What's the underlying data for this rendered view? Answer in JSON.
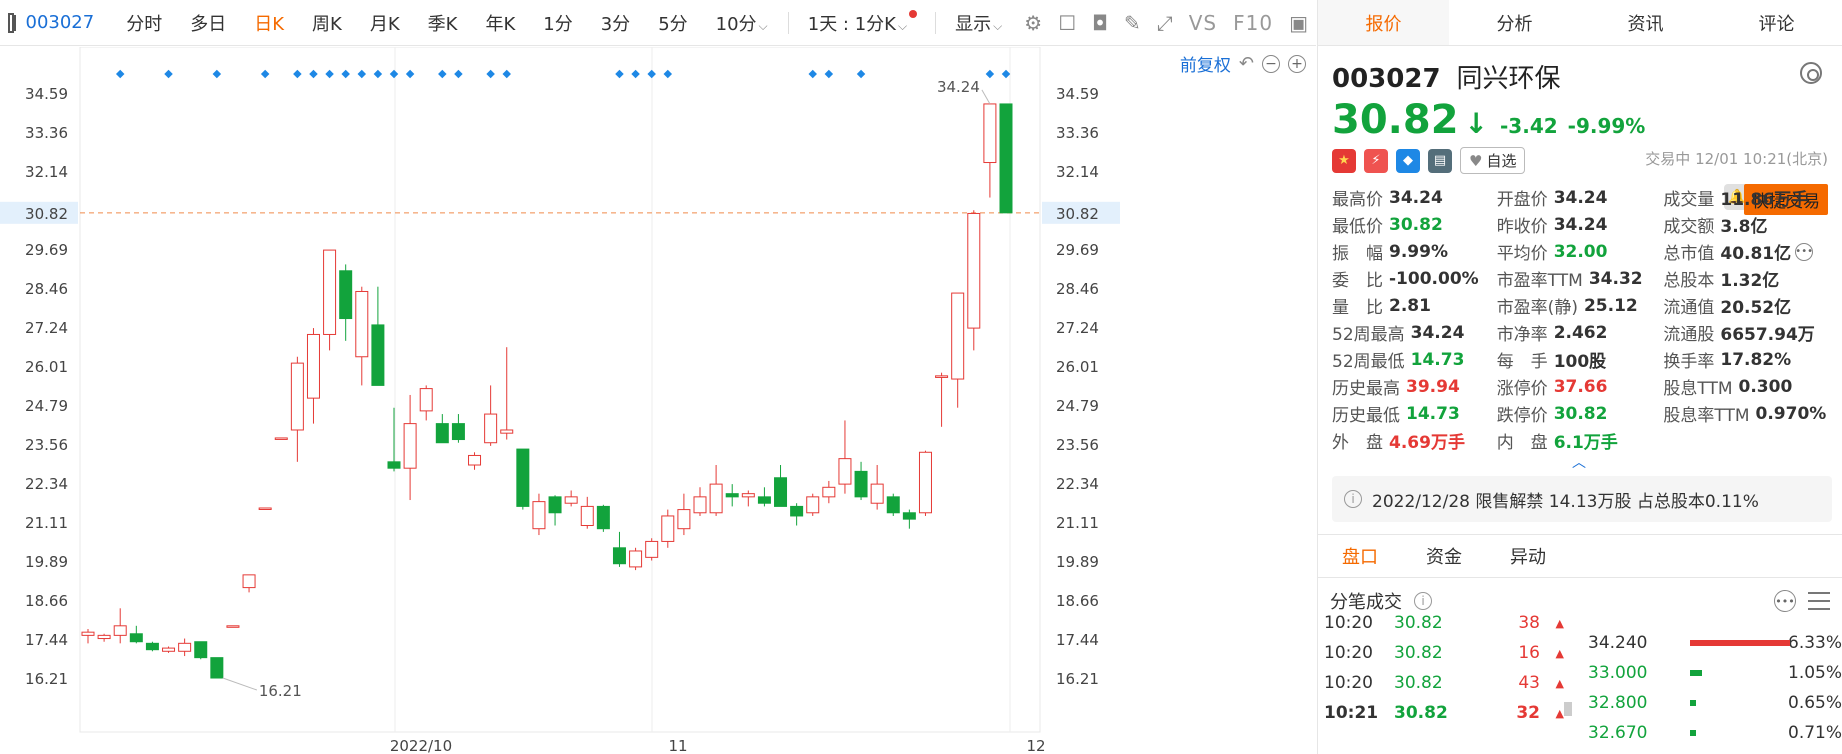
{
  "toolbar": {
    "code": "003027",
    "items": [
      "分时",
      "多日",
      "日K",
      "周K",
      "月K",
      "季K",
      "年K",
      "1分",
      "3分",
      "5分"
    ],
    "active": "日K",
    "period_select": "10分",
    "range_select": "1天 : 1分K",
    "display_label": "显示",
    "vs_label": "VS",
    "f10_label": "F10"
  },
  "chart": {
    "fq_label": "前复权",
    "last_price": "30.82",
    "high_label": "34.24",
    "low_label": "16.21",
    "x_labels": [
      "2022/10",
      "11",
      "12"
    ]
  },
  "chart_data": {
    "type": "candlestick",
    "y_ticks": [
      34.59,
      33.36,
      32.14,
      30.82,
      29.69,
      28.46,
      27.24,
      26.01,
      24.79,
      23.56,
      22.34,
      21.11,
      19.89,
      18.66,
      17.44,
      16.21
    ],
    "ylim": [
      15.3,
      35.4
    ],
    "x_labels": [
      "2022/10",
      "11",
      "12"
    ],
    "candles": [
      {
        "o": 17.55,
        "c": 17.65,
        "h": 17.75,
        "l": 17.3
      },
      {
        "o": 17.45,
        "c": 17.55,
        "h": 17.6,
        "l": 17.35
      },
      {
        "o": 17.55,
        "c": 17.85,
        "h": 18.4,
        "l": 17.3
      },
      {
        "o": 17.6,
        "c": 17.35,
        "h": 17.85,
        "l": 17.3
      },
      {
        "o": 17.3,
        "c": 17.1,
        "h": 17.35,
        "l": 17.05
      },
      {
        "o": 17.05,
        "c": 17.15,
        "h": 17.2,
        "l": 17.0
      },
      {
        "o": 17.05,
        "c": 17.3,
        "h": 17.45,
        "l": 16.9
      },
      {
        "o": 17.35,
        "c": 16.85,
        "h": 17.35,
        "l": 16.8
      },
      {
        "o": 16.85,
        "c": 16.21,
        "h": 16.85,
        "l": 16.21
      },
      {
        "o": 17.85,
        "c": 17.85,
        "h": 17.85,
        "l": 17.85
      },
      {
        "o": 19.05,
        "c": 19.45,
        "h": 19.45,
        "l": 18.9
      },
      {
        "o": 21.55,
        "c": 21.55,
        "h": 21.55,
        "l": 21.55
      },
      {
        "o": 23.75,
        "c": 23.75,
        "h": 23.75,
        "l": 23.75
      },
      {
        "o": 24.0,
        "c": 26.1,
        "h": 26.3,
        "l": 23.0
      },
      {
        "o": 25.0,
        "c": 27.0,
        "h": 27.2,
        "l": 24.2
      },
      {
        "o": 27.0,
        "c": 29.65,
        "h": 29.65,
        "l": 26.5
      },
      {
        "o": 29.0,
        "c": 27.5,
        "h": 29.2,
        "l": 26.8
      },
      {
        "o": 26.3,
        "c": 28.35,
        "h": 28.5,
        "l": 25.4
      },
      {
        "o": 27.3,
        "c": 25.4,
        "h": 28.5,
        "l": 25.4
      },
      {
        "o": 23.0,
        "c": 22.8,
        "h": 24.7,
        "l": 22.7
      },
      {
        "o": 22.8,
        "c": 24.2,
        "h": 25.1,
        "l": 21.8
      },
      {
        "o": 24.6,
        "c": 25.3,
        "h": 25.4,
        "l": 24.3
      },
      {
        "o": 24.2,
        "c": 23.6,
        "h": 24.5,
        "l": 23.6
      },
      {
        "o": 24.2,
        "c": 23.7,
        "h": 24.5,
        "l": 23.6
      },
      {
        "o": 22.9,
        "c": 23.2,
        "h": 23.3,
        "l": 22.75
      },
      {
        "o": 23.6,
        "c": 24.5,
        "h": 25.4,
        "l": 23.5
      },
      {
        "o": 23.9,
        "c": 24.0,
        "h": 26.6,
        "l": 23.7
      },
      {
        "o": 23.4,
        "c": 21.6,
        "h": 23.4,
        "l": 21.5
      },
      {
        "o": 20.9,
        "c": 21.75,
        "h": 22.0,
        "l": 20.7
      },
      {
        "o": 21.9,
        "c": 21.4,
        "h": 21.95,
        "l": 21.0
      },
      {
        "o": 21.7,
        "c": 21.9,
        "h": 22.1,
        "l": 21.6
      },
      {
        "o": 21.0,
        "c": 21.6,
        "h": 21.9,
        "l": 20.9
      },
      {
        "o": 21.6,
        "c": 20.9,
        "h": 21.65,
        "l": 20.8
      },
      {
        "o": 20.3,
        "c": 19.8,
        "h": 20.8,
        "l": 19.7
      },
      {
        "o": 19.7,
        "c": 20.2,
        "h": 20.3,
        "l": 19.6
      },
      {
        "o": 20.0,
        "c": 20.5,
        "h": 20.6,
        "l": 19.9
      },
      {
        "o": 20.5,
        "c": 21.3,
        "h": 21.5,
        "l": 20.3
      },
      {
        "o": 20.9,
        "c": 21.5,
        "h": 22.0,
        "l": 20.7
      },
      {
        "o": 21.4,
        "c": 21.9,
        "h": 22.2,
        "l": 21.3
      },
      {
        "o": 21.4,
        "c": 22.3,
        "h": 22.9,
        "l": 21.3
      },
      {
        "o": 22.0,
        "c": 21.9,
        "h": 22.3,
        "l": 21.6
      },
      {
        "o": 21.9,
        "c": 22.0,
        "h": 22.1,
        "l": 21.6
      },
      {
        "o": 21.9,
        "c": 21.7,
        "h": 22.2,
        "l": 21.6
      },
      {
        "o": 22.5,
        "c": 21.6,
        "h": 22.9,
        "l": 21.6
      },
      {
        "o": 21.6,
        "c": 21.3,
        "h": 21.7,
        "l": 21.0
      },
      {
        "o": 21.4,
        "c": 21.9,
        "h": 22.0,
        "l": 21.3
      },
      {
        "o": 21.9,
        "c": 22.2,
        "h": 22.4,
        "l": 21.7
      },
      {
        "o": 22.3,
        "c": 23.1,
        "h": 24.3,
        "l": 22.0
      },
      {
        "o": 22.7,
        "c": 21.9,
        "h": 23.0,
        "l": 21.8
      },
      {
        "o": 21.7,
        "c": 22.3,
        "h": 22.9,
        "l": 21.5
      },
      {
        "o": 21.9,
        "c": 21.4,
        "h": 22.0,
        "l": 21.3
      },
      {
        "o": 21.4,
        "c": 21.2,
        "h": 21.5,
        "l": 20.9
      },
      {
        "o": 21.4,
        "c": 23.3,
        "h": 23.35,
        "l": 21.3
      },
      {
        "o": 25.65,
        "c": 25.7,
        "h": 25.8,
        "l": 24.1
      },
      {
        "o": 25.6,
        "c": 28.3,
        "h": 28.3,
        "l": 24.7
      },
      {
        "o": 27.2,
        "c": 30.8,
        "h": 30.9,
        "l": 26.5
      },
      {
        "o": 32.4,
        "c": 34.24,
        "h": 34.24,
        "l": 31.3
      },
      {
        "o": 34.24,
        "c": 30.82,
        "h": 34.24,
        "l": 30.82
      }
    ]
  },
  "panel": {
    "tabs": [
      "报价",
      "分析",
      "资讯",
      "评论"
    ],
    "code": "003027",
    "name": "同兴环保",
    "price": "30.82",
    "arrow": "↓",
    "change": "-3.42",
    "change_pct": "-9.99%",
    "status": "交易中 12/01 10:21(北京)",
    "watch_label": "自选",
    "trade_label": "快捷交易",
    "stats": [
      [
        {
          "l": "最高价",
          "v": "34.24",
          "c": "dk"
        },
        {
          "l": "开盘价",
          "v": "34.24",
          "c": "dk"
        },
        {
          "l": "成交量",
          "v": "11.86万手",
          "c": "dk"
        }
      ],
      [
        {
          "l": "最低价",
          "v": "30.82",
          "c": "green"
        },
        {
          "l": "昨收价",
          "v": "34.24",
          "c": "dk"
        },
        {
          "l": "成交额",
          "v": "3.8亿",
          "c": "dk"
        }
      ],
      [
        {
          "l": "振　幅",
          "v": "9.99%",
          "c": "dk"
        },
        {
          "l": "平均价",
          "v": "32.00",
          "c": "green"
        },
        {
          "l": "总市值",
          "v": "40.81亿",
          "c": "dk"
        }
      ],
      [
        {
          "l": "委　比",
          "v": "-100.00%",
          "c": "dk"
        },
        {
          "l": "市盈率TTM",
          "v": "34.32",
          "c": "dk"
        },
        {
          "l": "总股本",
          "v": "1.32亿",
          "c": "dk"
        }
      ],
      [
        {
          "l": "量　比",
          "v": "2.81",
          "c": "dk"
        },
        {
          "l": "市盈率(静)",
          "v": "25.12",
          "c": "dk"
        },
        {
          "l": "流通值",
          "v": "20.52亿",
          "c": "dk"
        }
      ],
      [
        {
          "l": "52周最高",
          "v": "34.24",
          "c": "dk"
        },
        {
          "l": "市净率",
          "v": "2.462",
          "c": "dk"
        },
        {
          "l": "流通股",
          "v": "6657.94万",
          "c": "dk"
        }
      ],
      [
        {
          "l": "52周最低",
          "v": "14.73",
          "c": "green"
        },
        {
          "l": "每　手",
          "v": "100股",
          "c": "dk"
        },
        {
          "l": "换手率",
          "v": "17.82%",
          "c": "dk"
        }
      ],
      [
        {
          "l": "历史最高",
          "v": "39.94",
          "c": "red"
        },
        {
          "l": "涨停价",
          "v": "37.66",
          "c": "red"
        },
        {
          "l": "股息TTM",
          "v": "0.300",
          "c": "dk"
        }
      ],
      [
        {
          "l": "历史最低",
          "v": "14.73",
          "c": "green"
        },
        {
          "l": "跌停价",
          "v": "30.82",
          "c": "green"
        },
        {
          "l": "股息率TTM",
          "v": "0.970%",
          "c": "dk"
        }
      ],
      [
        {
          "l": "外　盘",
          "v": "4.69万手",
          "c": "red"
        },
        {
          "l": "内　盘",
          "v": "6.1万手",
          "c": "green"
        },
        {
          "l": "",
          "v": "",
          "c": "dk"
        }
      ]
    ],
    "notice": "2022/12/28  限售解禁 14.13万股 占总股本0.11%",
    "sub_tabs": [
      "盘口",
      "资金",
      "异动"
    ],
    "tick_title": "分笔成交",
    "ticks": [
      {
        "t": "10:20",
        "p": "30.82",
        "v": "38",
        "bold": false
      },
      {
        "t": "10:20",
        "p": "30.82",
        "v": "16",
        "bold": false
      },
      {
        "t": "10:20",
        "p": "30.82",
        "v": "43",
        "bold": false
      },
      {
        "t": "10:21",
        "p": "30.82",
        "v": "32",
        "bold": true
      }
    ],
    "distribution": [
      {
        "price": "34.240",
        "pct": "6.33%",
        "ratio": 1.0,
        "color": "red"
      },
      {
        "price": "33.000",
        "pct": "1.05%",
        "ratio": 0.12,
        "color": "green"
      },
      {
        "price": "32.800",
        "pct": "0.65%",
        "ratio": 0.06,
        "color": "green"
      },
      {
        "price": "32.670",
        "pct": "0.71%",
        "ratio": 0.06,
        "color": "green"
      }
    ]
  }
}
